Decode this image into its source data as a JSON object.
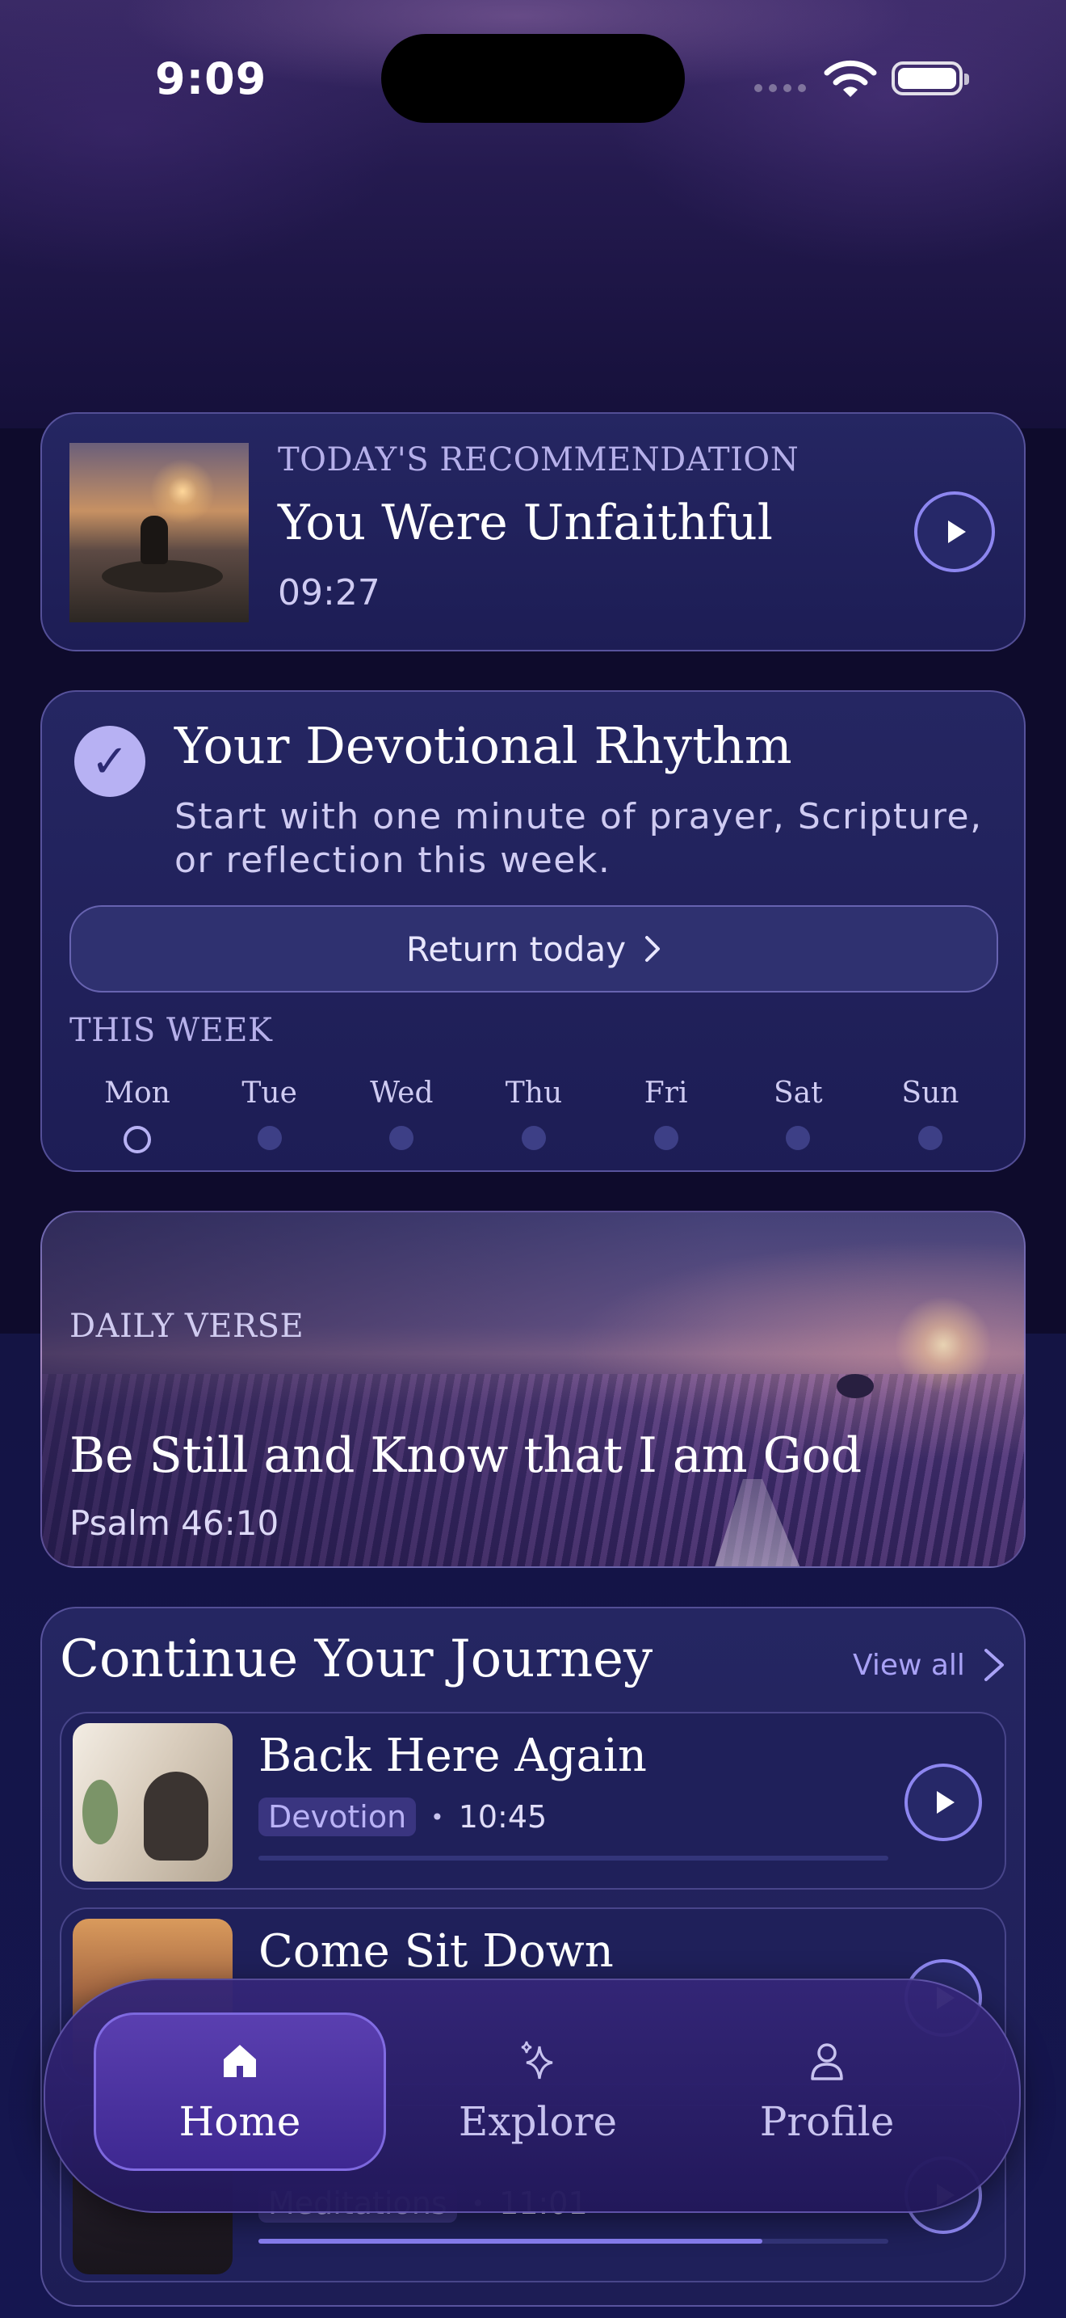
{
  "status_bar": {
    "time": "9:09"
  },
  "recommendation": {
    "eyebrow": "TODAY'S RECOMMENDATION",
    "title": "You Were Unfaithful",
    "duration": "09:27"
  },
  "rhythm": {
    "title": "Your Devotional Rhythm",
    "description": "Start with one minute of prayer, Scripture, or reflection this week.",
    "button_label": "Return today",
    "week_label": "THIS WEEK",
    "days": [
      {
        "name": "Mon",
        "state": "today"
      },
      {
        "name": "Tue",
        "state": "empty"
      },
      {
        "name": "Wed",
        "state": "empty"
      },
      {
        "name": "Thu",
        "state": "empty"
      },
      {
        "name": "Fri",
        "state": "empty"
      },
      {
        "name": "Sat",
        "state": "empty"
      },
      {
        "name": "Sun",
        "state": "empty"
      }
    ]
  },
  "daily_verse": {
    "eyebrow": "DAILY VERSE",
    "text": "Be Still and Know that I am God",
    "reference": "Psalm 46:10"
  },
  "journey": {
    "title": "Continue Your Journey",
    "view_all": "View all",
    "items": [
      {
        "title": "Back Here Again",
        "category": "Devotion",
        "duration": "10:45",
        "progress": 0.0
      },
      {
        "title": "Come Sit Down",
        "category": "",
        "duration": "",
        "progress": 0.0
      },
      {
        "title": "",
        "category": "Meditations",
        "duration": "11:01",
        "progress": 0.8
      }
    ]
  },
  "tabbar": {
    "tabs": [
      {
        "label": "Home",
        "icon": "house-icon",
        "active": true
      },
      {
        "label": "Explore",
        "icon": "sparkles-icon",
        "active": false
      },
      {
        "label": "Profile",
        "icon": "person-icon",
        "active": false
      }
    ]
  },
  "colors": {
    "accent": "#8d86f0",
    "card_bg": "#1f205a",
    "tab_active": "#4a32a0",
    "background": "#0e0b2c"
  }
}
